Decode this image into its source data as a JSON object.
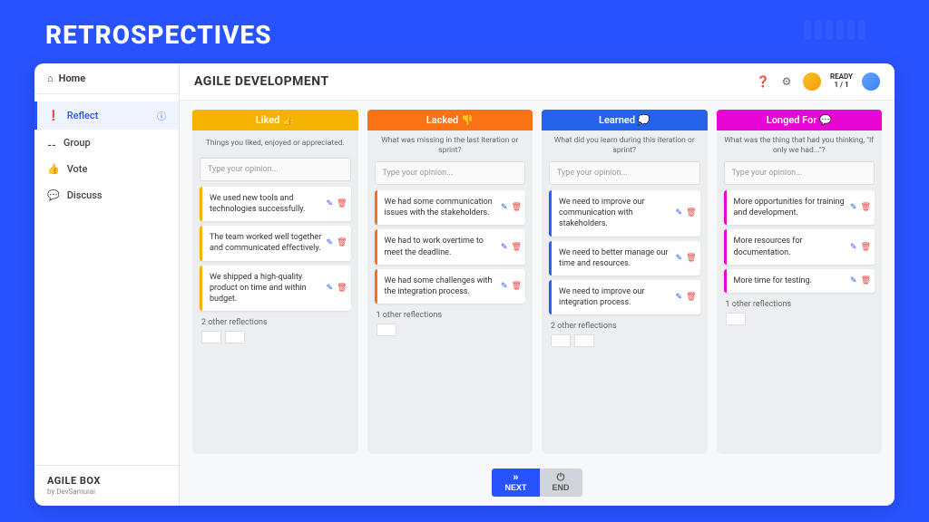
{
  "page_title": "RETROSPECTIVES",
  "sidebar": {
    "home": "Home",
    "items": [
      {
        "label": "Reflect",
        "active": true
      },
      {
        "label": "Group"
      },
      {
        "label": "Vote"
      },
      {
        "label": "Discuss"
      }
    ],
    "brand": "AGILE BOX",
    "brand_by": "by DevSamurai"
  },
  "topbar": {
    "title": "AGILE DEVELOPMENT",
    "ready_label": "READY",
    "ready_count": "1 / 1"
  },
  "columns": [
    {
      "title": "Liked 👍",
      "color": "yellow",
      "desc": "Things you liked, enjoyed or appreciated.",
      "placeholder": "Type your opinion...",
      "cards": [
        "We used new tools and technologies successfully.",
        "The team worked well together and communicated effectively.",
        "We shipped a high-quality product on time and within budget."
      ],
      "other": "2 other reflections",
      "other_count": 2
    },
    {
      "title": "Lacked 👎",
      "color": "orange",
      "desc": "What was missing in the last iteration or sprint?",
      "placeholder": "Type your opinion...",
      "cards": [
        "We had some communication issues with the stakeholders.",
        "We had to work overtime to meet the deadline.",
        "We had some challenges with the integration process."
      ],
      "other": "1 other reflections",
      "other_count": 1
    },
    {
      "title": "Learned 💭",
      "color": "blue",
      "desc": "What did you learn during this iteration or sprint?",
      "placeholder": "Type your opinion...",
      "cards": [
        "We need to improve our communication with stakeholders.",
        "We need to better manage our time and resources.",
        "We need to improve our integration process."
      ],
      "other": "2 other reflections",
      "other_count": 2
    },
    {
      "title": "Longed For 💬",
      "color": "pink",
      "desc": "What was the thing that had you thinking, \"If only we had...\"?",
      "placeholder": "Type your opinion...",
      "cards": [
        "More opportunities for training and development.",
        "More resources for documentation.",
        "More time for testing."
      ],
      "other": "1 other reflections",
      "other_count": 1
    }
  ],
  "footer": {
    "next": "NEXT",
    "end": "END"
  }
}
